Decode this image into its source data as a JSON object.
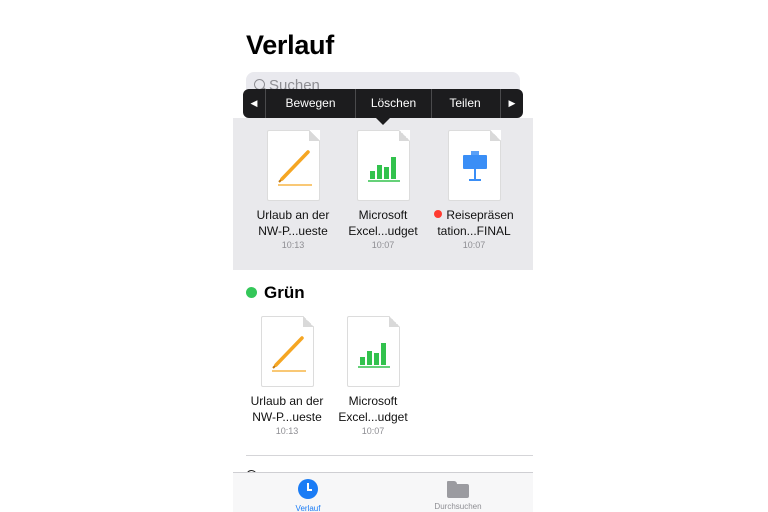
{
  "title": "Verlauf",
  "search": {
    "placeholder": "Suchen"
  },
  "context_menu": {
    "prev_arrow": "◀",
    "next_arrow": "▶",
    "items": [
      "Bewegen",
      "Löschen",
      "Teilen"
    ]
  },
  "recents": [
    {
      "icon": "pages-icon",
      "line1": "Urlaub an der",
      "line2": "NW-P...ueste",
      "time": "10:13"
    },
    {
      "icon": "numbers-icon",
      "line1": "Microsoft",
      "line2": "Excel...udget",
      "time": "10:07"
    },
    {
      "icon": "keynote-icon",
      "line1": "Reisepräsen",
      "line2": "tation...FINAL",
      "time": "10:07",
      "tag_color": "#ff3b30"
    }
  ],
  "tag_section": {
    "title": "Grün",
    "color": "#34c759",
    "files": [
      {
        "icon": "pages-icon",
        "line1": "Urlaub an der",
        "line2": "NW-P...ueste",
        "time": "10:13"
      },
      {
        "icon": "numbers-icon",
        "line1": "Microsoft",
        "line2": "Excel...udget",
        "time": "10:07"
      }
    ]
  },
  "tabbar": {
    "active": "Verlauf",
    "items": [
      {
        "label": "Verlauf",
        "icon": "clock-icon"
      },
      {
        "label": "Durchsuchen",
        "icon": "folder-icon"
      }
    ]
  }
}
